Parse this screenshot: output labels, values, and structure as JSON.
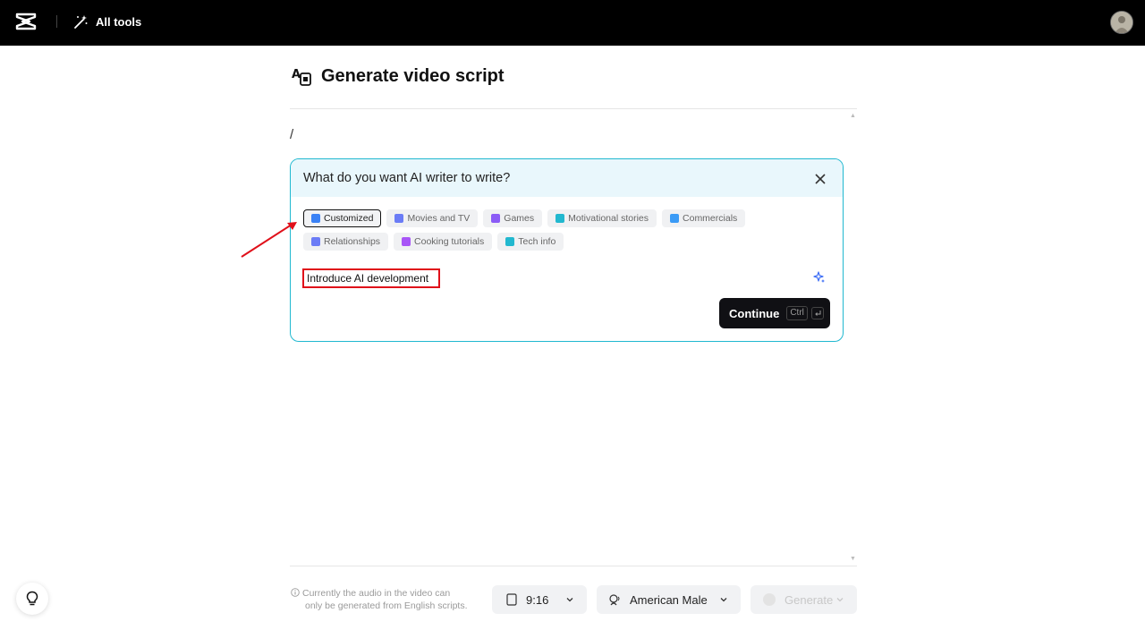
{
  "topbar": {
    "all_tools_label": "All tools"
  },
  "page": {
    "title": "Generate video script"
  },
  "editor": {
    "content": "/"
  },
  "ai_panel": {
    "question": "What do you want AI writer to write?",
    "chips": [
      {
        "label": "Customized",
        "icon": "edit-icon",
        "color": "#3b82f6",
        "active": true
      },
      {
        "label": "Movies and TV",
        "icon": "film-icon",
        "color": "#6b7cf6",
        "active": false
      },
      {
        "label": "Games",
        "icon": "gamepad-icon",
        "color": "#8b5cf6",
        "active": false
      },
      {
        "label": "Motivational stories",
        "icon": "pin-icon",
        "color": "#22b8cf",
        "active": false
      },
      {
        "label": "Commercials",
        "icon": "tv-icon",
        "color": "#3b9bf6",
        "active": false
      },
      {
        "label": "Relationships",
        "icon": "people-icon",
        "color": "#6b7cf6",
        "active": false
      },
      {
        "label": "Cooking tutorials",
        "icon": "cup-icon",
        "color": "#a855f7",
        "active": false
      },
      {
        "label": "Tech info",
        "icon": "rocket-icon",
        "color": "#22b8cf",
        "active": false
      }
    ],
    "prompt_value": "Introduce AI development",
    "continue_label": "Continue",
    "shortcut_key": "Ctrl"
  },
  "bottom": {
    "hint_line1": "Currently the audio in the video can",
    "hint_line2": "only be generated from English scripts.",
    "ratio": "9:16",
    "voice": "American Male",
    "generate_label": "Generate"
  },
  "colors": {
    "accent_border": "#20b8d0",
    "highlight": "#e0101a",
    "panel_header": "#e9f7fc"
  }
}
